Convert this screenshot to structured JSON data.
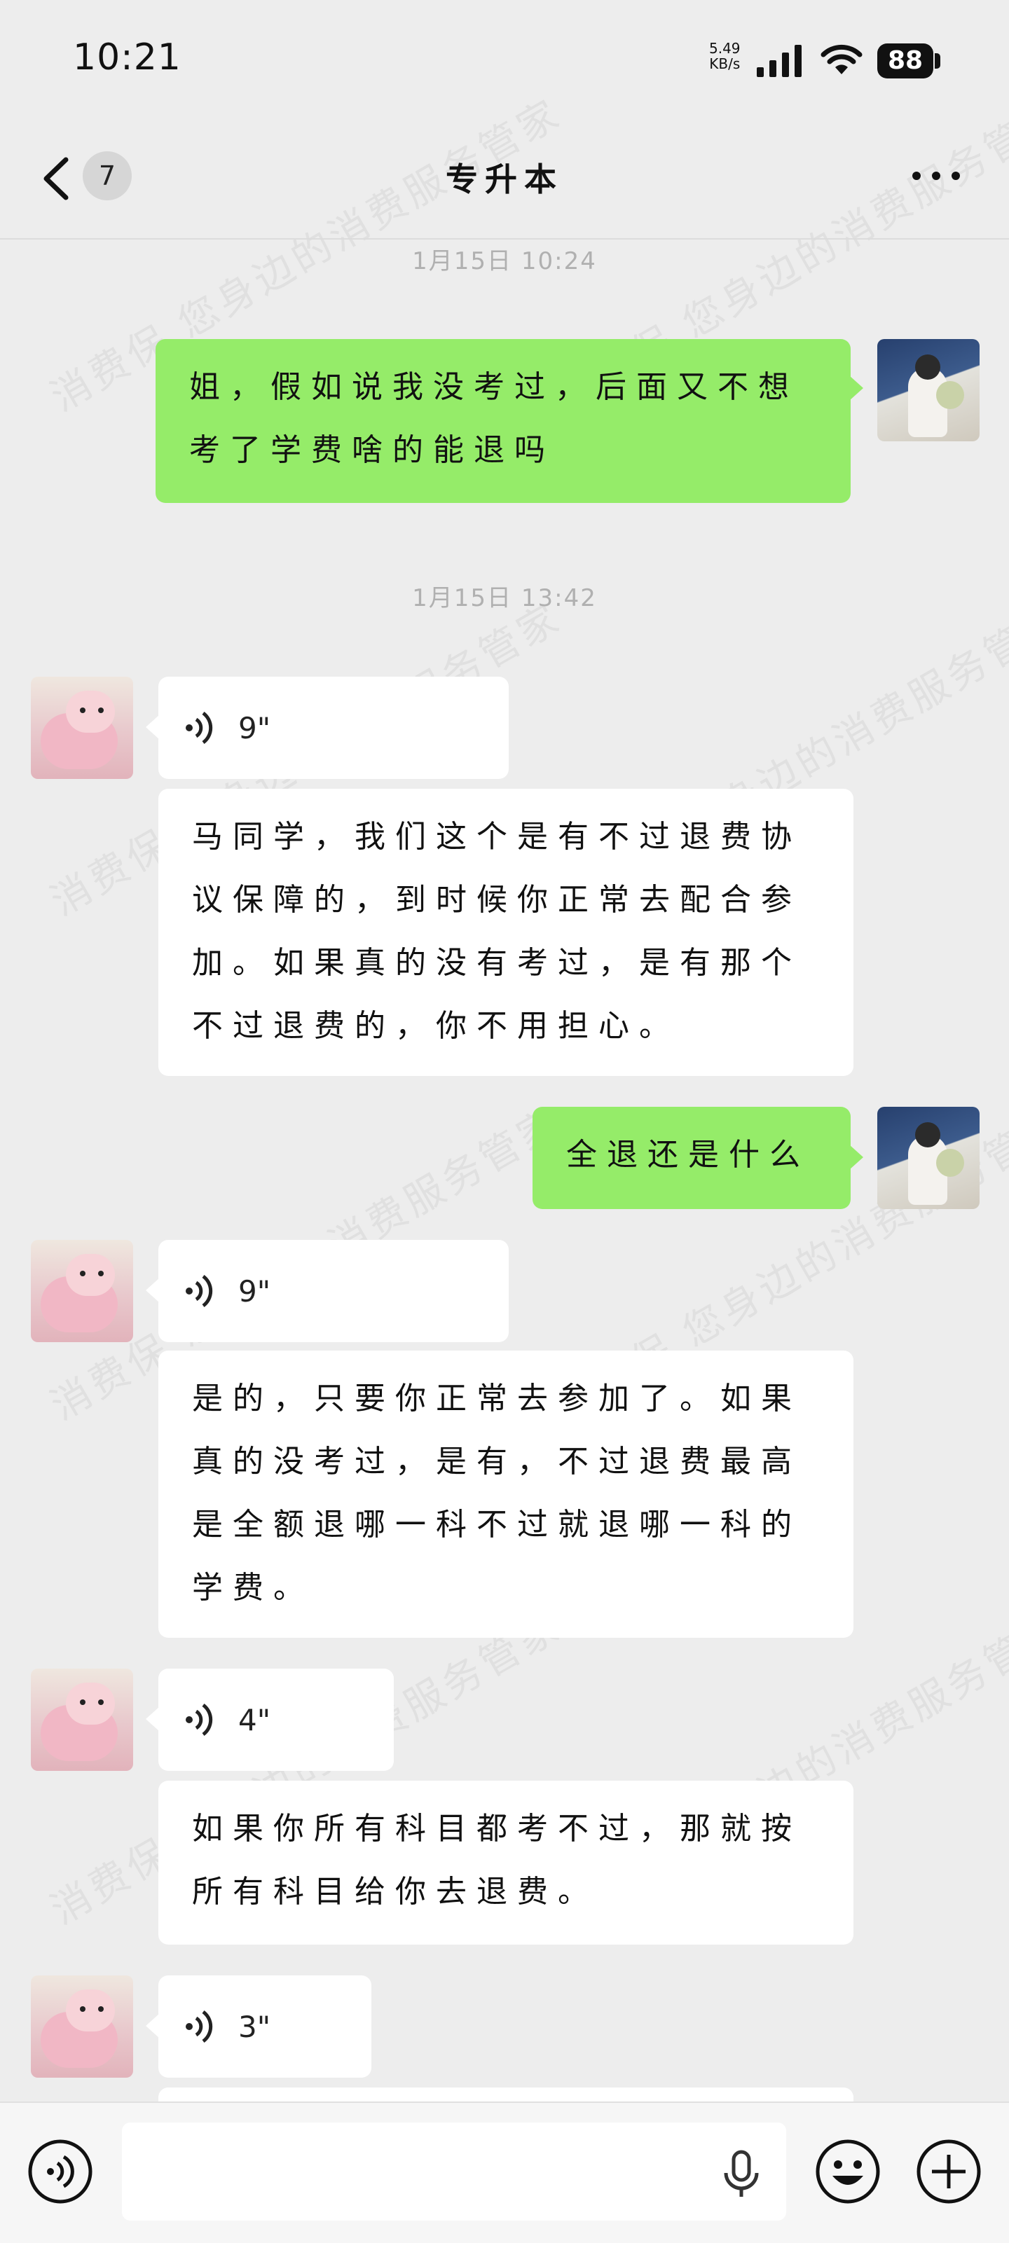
{
  "status_bar": {
    "time": "10:21",
    "net_speed_value": "5.49",
    "net_speed_unit": "KB/s",
    "battery": "88"
  },
  "nav": {
    "unread_count": "7",
    "title": "专升本"
  },
  "messages": [
    {
      "type": "timestamp",
      "text": "1月15日 10:24"
    },
    {
      "type": "text",
      "side": "right",
      "text": "姐，假如说我没考过，后面又不想考了学费啥的能退吗"
    },
    {
      "type": "timestamp",
      "text": "1月15日 13:42"
    },
    {
      "type": "voice",
      "side": "left",
      "duration": "9\""
    },
    {
      "type": "text",
      "side": "left",
      "text": "马同学，我们这个是有不过退费协议保障的，到时候你正常去配合参加。如果真的没有考过，是有那个不过退费的，你不用担心。"
    },
    {
      "type": "text",
      "side": "right",
      "text": "全退还是什么"
    },
    {
      "type": "voice",
      "side": "left",
      "duration": "9\""
    },
    {
      "type": "text",
      "side": "left",
      "text": "是的，只要你正常去参加了。如果真的没考过，是有，不过退费最高是全额退哪一科不过就退哪一科的学费。"
    },
    {
      "type": "voice",
      "side": "left",
      "duration": "4\""
    },
    {
      "type": "text",
      "side": "left",
      "text": "如果你所有科目都考不过，那就按所有科目给你去退费。"
    },
    {
      "type": "voice",
      "side": "left",
      "duration": "3\""
    }
  ],
  "watermark": "消费保 您身边的消费服务管家",
  "colors": {
    "background": "#ededed",
    "self_bubble": "#95ec69",
    "other_bubble": "#ffffff",
    "timestamp": "#b0b0b0"
  },
  "icons": {
    "back": "chevron-left-icon",
    "more": "more-dots-icon",
    "voice_mode": "voice-mode-icon",
    "mic": "microphone-icon",
    "emoji": "emoji-icon",
    "add": "plus-icon"
  }
}
